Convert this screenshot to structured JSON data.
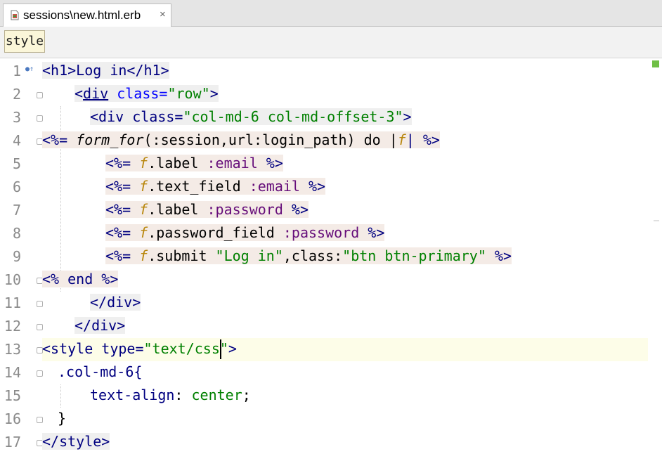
{
  "tab": {
    "label": "sessions\\new.html.erb",
    "close": "×",
    "icon": "erb-file-icon"
  },
  "breadcrumb": {
    "label": "style"
  },
  "gutter": {
    "line_numbers": [
      "1",
      "2",
      "3",
      "4",
      "5",
      "6",
      "7",
      "8",
      "9",
      "10",
      "11",
      "12",
      "13",
      "14",
      "15",
      "16",
      "17"
    ]
  },
  "code": {
    "l1": [
      "<",
      "h1",
      ">Log in</",
      "h1",
      ">"
    ],
    "l2": [
      "<",
      "div",
      " class=",
      "\"row\"",
      ">"
    ],
    "l3": [
      "<div class=",
      "\"col-md-6 col-md-offset-3\"",
      ">"
    ],
    "l4": [
      "<%=",
      " form_for",
      "(:session,url:login_path) do |",
      "f",
      "| %>"
    ],
    "l5": [
      "<%=",
      " f",
      ".label ",
      ":email",
      " %>"
    ],
    "l6": [
      "<%=",
      " f",
      ".text_field ",
      ":email",
      " %>"
    ],
    "l7": [
      "<%=",
      " f",
      ".label ",
      ":password",
      " %>"
    ],
    "l8": [
      "<%=",
      " f",
      ".password_field ",
      ":password",
      " %>"
    ],
    "l9": [
      "<%=",
      " f",
      ".submit ",
      "\"Log in\"",
      ",class:",
      "\"btn btn-primary\"",
      " %>"
    ],
    "l10": [
      "<% end %>"
    ],
    "l11": [
      "</div>"
    ],
    "l12": [
      "</div>"
    ],
    "l13": [
      "<style type=",
      "\"text/css",
      "\"",
      ">"
    ],
    "l14": [
      ".col-md-6{"
    ],
    "l15": [
      "text-align",
      ": ",
      "center",
      ";"
    ],
    "l16": [
      "}"
    ],
    "l17": [
      "</style>"
    ]
  },
  "colors": {
    "tag": "#000080",
    "attribute": "#0000ff",
    "string": "#008000",
    "symbol": "#660e7a",
    "block_param": "#b8860b",
    "caret_line": "#fdfde8"
  }
}
